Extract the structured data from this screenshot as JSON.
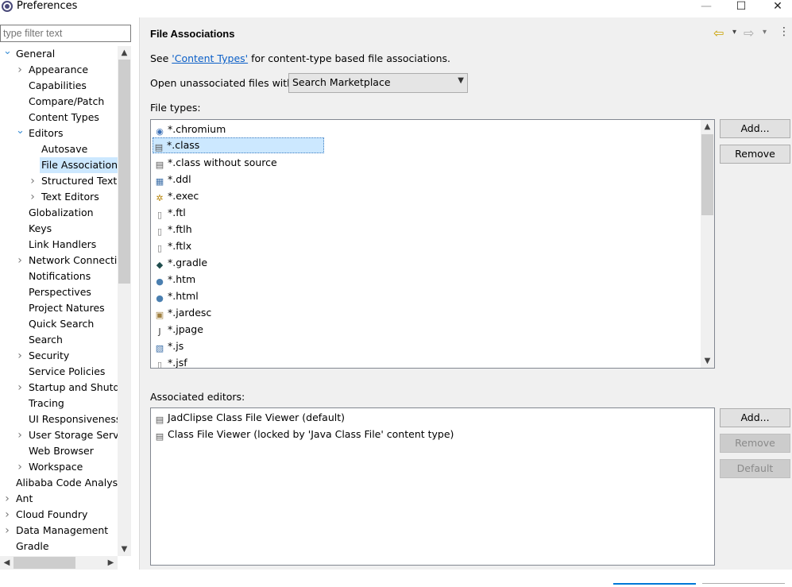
{
  "window": {
    "title": "Preferences",
    "minimize_glyph": "—",
    "maximize_glyph": "☐",
    "close_glyph": "✕"
  },
  "filter": {
    "placeholder": "type filter text"
  },
  "tree": {
    "items": [
      {
        "label": "General",
        "twisty": "⌄",
        "indent": 0
      },
      {
        "label": "Appearance",
        "twisty": "›",
        "indent": 1
      },
      {
        "label": "Capabilities",
        "twisty": "",
        "indent": 1
      },
      {
        "label": "Compare/Patch",
        "twisty": "",
        "indent": 1
      },
      {
        "label": "Content Types",
        "twisty": "",
        "indent": 1
      },
      {
        "label": "Editors",
        "twisty": "⌄",
        "indent": 1
      },
      {
        "label": "Autosave",
        "twisty": "",
        "indent": 2
      },
      {
        "label": "File Associations",
        "twisty": "",
        "indent": 2,
        "selected": true
      },
      {
        "label": "Structured Text E",
        "twisty": "›",
        "indent": 2
      },
      {
        "label": "Text Editors",
        "twisty": "›",
        "indent": 2
      },
      {
        "label": "Globalization",
        "twisty": "",
        "indent": 1
      },
      {
        "label": "Keys",
        "twisty": "",
        "indent": 1
      },
      {
        "label": "Link Handlers",
        "twisty": "",
        "indent": 1
      },
      {
        "label": "Network Connectio",
        "twisty": "›",
        "indent": 1
      },
      {
        "label": "Notifications",
        "twisty": "",
        "indent": 1
      },
      {
        "label": "Perspectives",
        "twisty": "",
        "indent": 1
      },
      {
        "label": "Project Natures",
        "twisty": "",
        "indent": 1
      },
      {
        "label": "Quick Search",
        "twisty": "",
        "indent": 1
      },
      {
        "label": "Search",
        "twisty": "",
        "indent": 1
      },
      {
        "label": "Security",
        "twisty": "›",
        "indent": 1
      },
      {
        "label": "Service Policies",
        "twisty": "",
        "indent": 1
      },
      {
        "label": "Startup and Shutdo",
        "twisty": "›",
        "indent": 1
      },
      {
        "label": "Tracing",
        "twisty": "",
        "indent": 1
      },
      {
        "label": "UI Responsiveness",
        "twisty": "",
        "indent": 1
      },
      {
        "label": "User Storage Servic",
        "twisty": "›",
        "indent": 1
      },
      {
        "label": "Web Browser",
        "twisty": "",
        "indent": 1
      },
      {
        "label": "Workspace",
        "twisty": "›",
        "indent": 1
      },
      {
        "label": "Alibaba Code Analysis",
        "twisty": "",
        "indent": 0
      },
      {
        "label": "Ant",
        "twisty": "›",
        "indent": 0
      },
      {
        "label": "Cloud Foundry",
        "twisty": "›",
        "indent": 0
      },
      {
        "label": "Data Management",
        "twisty": "›",
        "indent": 0
      },
      {
        "label": "Gradle",
        "twisty": "",
        "indent": 0
      }
    ]
  },
  "page": {
    "title": "File Associations",
    "see_prefix": "See ",
    "see_link": "'Content Types'",
    "see_suffix": " for content-type based file associations.",
    "open_label": "Open unassociated files with:",
    "open_value": "Search Marketplace",
    "file_types_label": "File types:",
    "associated_label": "Associated editors:"
  },
  "file_types": [
    {
      "name": "*.chromium",
      "icon": "chromium-icon",
      "glyph": "◉",
      "color": "#3b6fb6"
    },
    {
      "name": "*.class",
      "icon": "class-file-icon",
      "glyph": "▤",
      "color": "#555",
      "selected": true
    },
    {
      "name": "*.class without source",
      "icon": "class-file-icon",
      "glyph": "▤",
      "color": "#555"
    },
    {
      "name": "*.ddl",
      "icon": "ddl-file-icon",
      "glyph": "▦",
      "color": "#3d6fa8"
    },
    {
      "name": "*.exec",
      "icon": "gears-icon",
      "glyph": "✲",
      "color": "#b8860b"
    },
    {
      "name": "*.ftl",
      "icon": "text-file-icon",
      "glyph": "▯",
      "color": "#777"
    },
    {
      "name": "*.ftlh",
      "icon": "text-file-icon",
      "glyph": "▯",
      "color": "#777"
    },
    {
      "name": "*.ftlx",
      "icon": "text-file-icon",
      "glyph": "▯",
      "color": "#777"
    },
    {
      "name": "*.gradle",
      "icon": "gradle-icon",
      "glyph": "◆",
      "color": "#1f4d4d"
    },
    {
      "name": "*.htm",
      "icon": "globe-icon",
      "glyph": "●",
      "color": "#4a7fb0"
    },
    {
      "name": "*.html",
      "icon": "globe-icon",
      "glyph": "●",
      "color": "#4a7fb0"
    },
    {
      "name": "*.jardesc",
      "icon": "jar-desc-icon",
      "glyph": "▣",
      "color": "#a08040"
    },
    {
      "name": "*.jpage",
      "icon": "jpage-icon",
      "glyph": "J",
      "color": "#333"
    },
    {
      "name": "*.js",
      "icon": "js-file-icon",
      "glyph": "▧",
      "color": "#3d6fa8"
    },
    {
      "name": "*.jsf",
      "icon": "text-file-icon",
      "glyph": "▯",
      "color": "#777"
    }
  ],
  "associated_editors": [
    {
      "name": "JadClipse Class File Viewer (default)",
      "icon": "class-file-icon",
      "glyph": "▤"
    },
    {
      "name": "Class File Viewer (locked by 'Java Class File' content type)",
      "icon": "class-file-icon",
      "glyph": "▤"
    }
  ],
  "buttons": {
    "add1": "Add...",
    "remove1": "Remove",
    "add2": "Add...",
    "remove2": "Remove",
    "default": "Default"
  },
  "nav": {
    "back": "⇦",
    "back_dd": "▾",
    "forward": "⇨",
    "forward_dd": "▾",
    "menu": "⋮"
  },
  "colors": {
    "selection": "#cce8ff",
    "link": "#0b5fc7",
    "back_arrow": "#c9a100"
  }
}
